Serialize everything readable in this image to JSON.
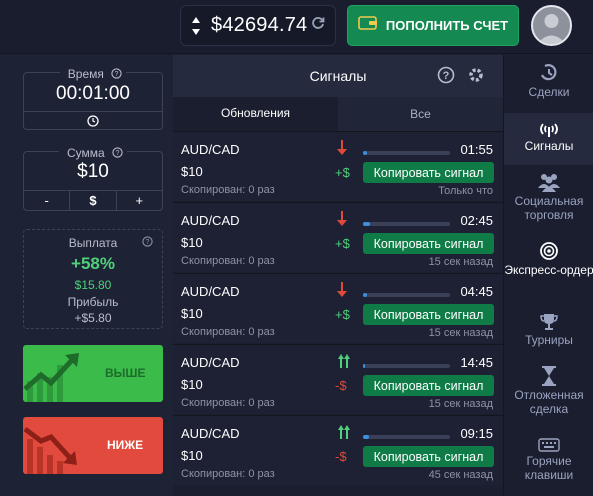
{
  "topbar": {
    "balance": "$42694.74",
    "deposit_label": "ПОПОЛНИТЬ СЧЕТ"
  },
  "left": {
    "time": {
      "label": "Время",
      "value": "00:01:00"
    },
    "sum": {
      "label": "Сумма",
      "value": "$10",
      "minus": "-",
      "dollar": "$",
      "plus": "+"
    },
    "payout": {
      "label": "Выплата",
      "percent": "+58%",
      "amount": "$15.80",
      "profit_label": "Прибыль",
      "profit": "+$5.80"
    },
    "up_label": "ВЫШЕ",
    "down_label": "НИЖЕ"
  },
  "signals": {
    "title": "Сигналы",
    "tabs": [
      "Обновления",
      "Все"
    ],
    "items": [
      {
        "pair": "AUD/CAD",
        "amount": "$10",
        "copied": "Скопирован: 0 раз",
        "direction": "down",
        "sign": "+$",
        "time": "01:55",
        "progress": 0.05,
        "button": "Копировать сигнал",
        "ago": "Только что"
      },
      {
        "pair": "AUD/CAD",
        "amount": "$10",
        "copied": "Скопирован: 0 раз",
        "direction": "down",
        "sign": "+$",
        "time": "02:45",
        "progress": 0.08,
        "button": "Копировать сигнал",
        "ago": "15 сек назад"
      },
      {
        "pair": "AUD/CAD",
        "amount": "$10",
        "copied": "Скопирован: 0 раз",
        "direction": "down",
        "sign": "+$",
        "time": "04:45",
        "progress": 0.05,
        "button": "Копировать сигнал",
        "ago": "15 сек назад"
      },
      {
        "pair": "AUD/CAD",
        "amount": "$10",
        "copied": "Скопирован: 0 раз",
        "direction": "up",
        "sign": "-$",
        "time": "14:45",
        "progress": 0.02,
        "button": "Копировать сигнал",
        "ago": "15 сек назад"
      },
      {
        "pair": "AUD/CAD",
        "amount": "$10",
        "copied": "Скопирован: 0 раз",
        "direction": "up",
        "sign": "-$",
        "time": "09:15",
        "progress": 0.07,
        "button": "Копировать сигнал",
        "ago": "45 сек назад"
      }
    ]
  },
  "nav": [
    {
      "label": "Сделки",
      "icon": "trades-icon"
    },
    {
      "label": "Сигналы",
      "icon": "signal-icon"
    },
    {
      "label": "Социальная торговля",
      "icon": "social-trading-icon"
    },
    {
      "label": "Экспресс-ордер",
      "icon": "express-order-icon"
    },
    {
      "label": "Турниры",
      "icon": "trophy-icon"
    },
    {
      "label": "Отложенная сделка",
      "icon": "hourglass-icon"
    },
    {
      "label": "Горячие клавиши",
      "icon": "keyboard-icon"
    }
  ]
}
